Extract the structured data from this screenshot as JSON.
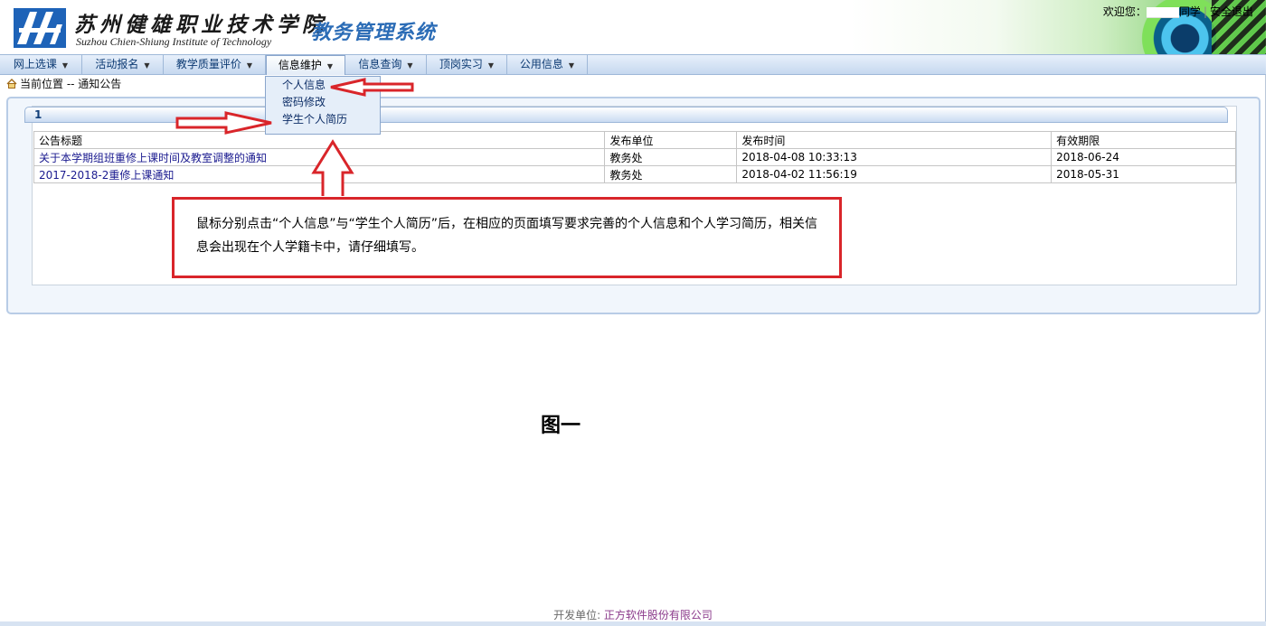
{
  "header": {
    "school_name_cn": "苏州健雄职业技术学院",
    "school_name_en": "Suzhou Chien-Shiung Institute of Technology",
    "system_title": "教务管理系统",
    "welcome": "欢迎您：",
    "user_suffix": "同学",
    "logout": "安全退出"
  },
  "nav": {
    "items": [
      {
        "label": "网上选课"
      },
      {
        "label": "活动报名"
      },
      {
        "label": "教学质量评价"
      },
      {
        "label": "信息维护"
      },
      {
        "label": "信息查询"
      },
      {
        "label": "顶岗实习"
      },
      {
        "label": "公用信息"
      }
    ],
    "active_index": 3,
    "dropdown": [
      {
        "label": "个人信息"
      },
      {
        "label": "密码修改"
      },
      {
        "label": "学生个人简历"
      }
    ]
  },
  "breadcrumb": "当前位置 -- 通知公告",
  "notices": {
    "page": "1",
    "headers": [
      "公告标题",
      "发布单位",
      "发布时间",
      "有效期限"
    ],
    "rows": [
      [
        "关于本学期组班重修上课时间及教室调整的通知",
        "教务处",
        "2018-04-08 10:33:13",
        "2018-06-24"
      ],
      [
        "2017-2018-2重修上课通知",
        "教务处",
        "2018-04-02 11:56:19",
        "2018-05-31"
      ]
    ]
  },
  "annotation": {
    "text": "鼠标分别点击“个人信息”与“学生个人简历”后，在相应的页面填写要求完善的个人信息和个人学习简历，相关信息会出现在个人学籍卡中，请仔细填写。",
    "figure_label": "图一",
    "arrow_color": "#d9252a"
  },
  "footer": {
    "prefix": "开发单位: ",
    "company": "正方软件股份有限公司"
  }
}
